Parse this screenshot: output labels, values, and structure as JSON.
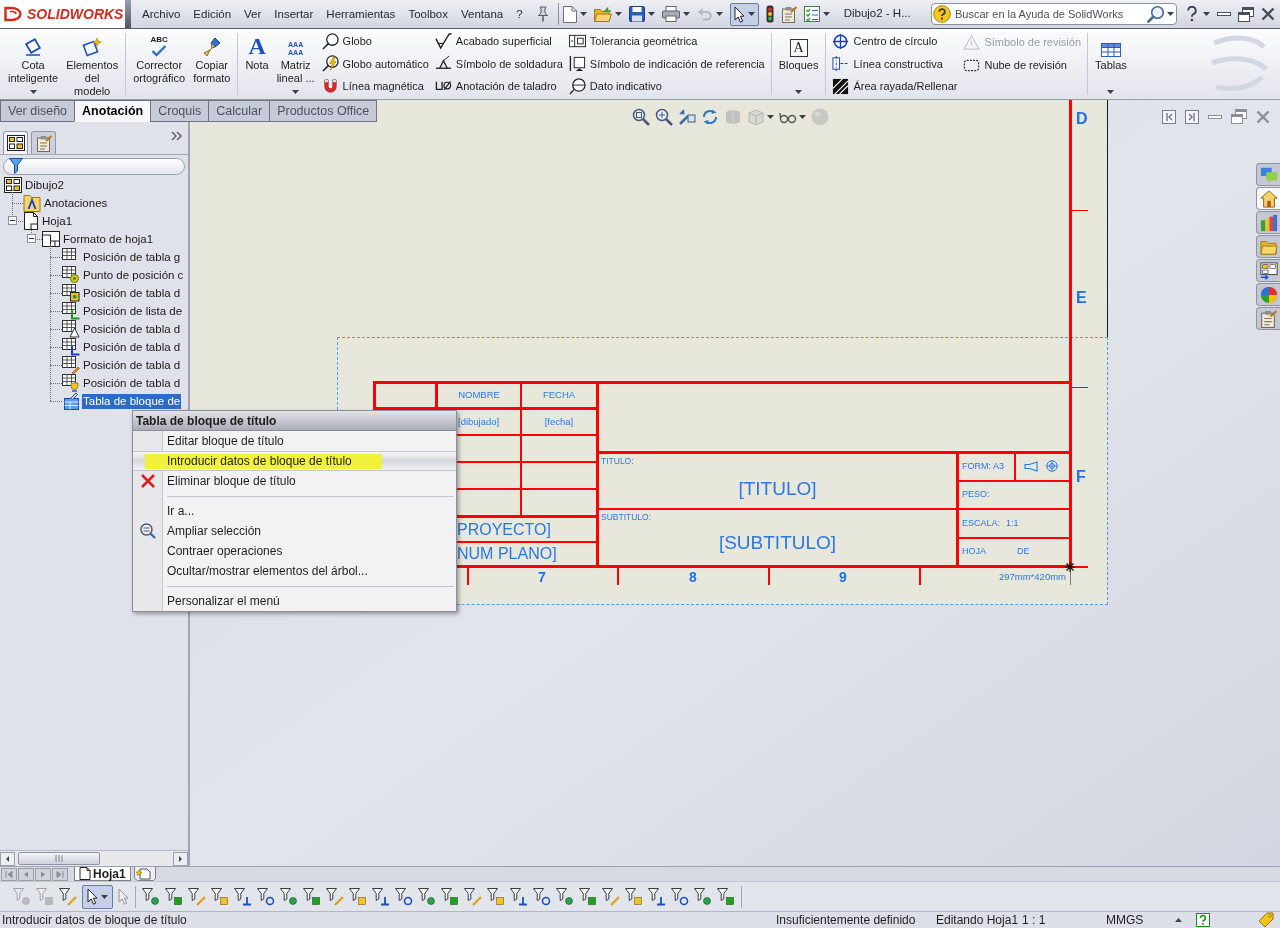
{
  "title_bar": {
    "logo": "SOLIDWORKS",
    "menu": [
      "Archivo",
      "Edición",
      "Ver",
      "Insertar",
      "Herramientas",
      "Toolbox",
      "Ventana",
      "?"
    ],
    "quick_tools": [
      {
        "dropdown": true,
        "selected": false,
        "disabled": false
      },
      {
        "dropdown": true,
        "selected": false,
        "disabled": false
      },
      {
        "dropdown": true,
        "selected": false,
        "disabled": false
      },
      {
        "dropdown": true,
        "selected": false,
        "disabled": false
      },
      {
        "dropdown": true,
        "selected": false,
        "disabled": true
      },
      {
        "dropdown": true,
        "selected": true,
        "disabled": false
      },
      {
        "dropdown": false,
        "selected": false,
        "disabled": false
      },
      {
        "dropdown": false,
        "selected": false,
        "disabled": false
      },
      {
        "dropdown": true,
        "selected": false,
        "disabled": false
      }
    ],
    "document_title": "Dibujo2 - H...",
    "search": {
      "placeholder": "Buscar en la Ayuda de SolidWorks"
    }
  },
  "ribbon": {
    "groups": [
      [
        {
          "kind": "large",
          "label": "Cota\ninteligente",
          "dropdown": true
        },
        {
          "kind": "large",
          "label": "Elementos\ndel\nmodelo",
          "dropdown": false
        }
      ],
      [
        {
          "kind": "large",
          "glyph": "ABC",
          "label": "Corrector\nortográfico",
          "dropdown": false
        },
        {
          "kind": "large",
          "label": "Copiar\nformato",
          "dropdown": false
        }
      ],
      [
        {
          "kind": "large",
          "glyph": "A",
          "label": "Nota",
          "dropdown": false
        },
        {
          "kind": "large",
          "glyph": "AAA\nAAA",
          "label": "Matriz\nlineal ...",
          "dropdown": true
        },
        {
          "kind": "column",
          "items": [
            {
              "label": "Globo",
              "disabled": false
            },
            {
              "label": "Globo automático",
              "disabled": false
            },
            {
              "label": "Línea magnética",
              "disabled": false
            }
          ]
        },
        {
          "kind": "column",
          "items": [
            {
              "label": "Acabado superficial",
              "disabled": false
            },
            {
              "label": "Símbolo de soldadura",
              "disabled": false
            },
            {
              "label": "Anotación de taladro",
              "disabled": false
            }
          ]
        },
        {
          "kind": "column",
          "items": [
            {
              "label": "Tolerancia geométrica",
              "disabled": false
            },
            {
              "label": "Símbolo de indicación de referencia",
              "disabled": false
            },
            {
              "label": "Dato indicativo",
              "disabled": false
            }
          ]
        }
      ],
      [
        {
          "kind": "large",
          "glyph": "A",
          "label": "Bloques",
          "dropdown": true
        }
      ],
      [
        {
          "kind": "column",
          "items": [
            {
              "label": "Centro de círculo",
              "disabled": false
            },
            {
              "label": "Línea constructiva",
              "disabled": false
            },
            {
              "label": "Área rayada/Rellenar",
              "disabled": false
            }
          ]
        },
        {
          "kind": "column",
          "items": [
            {
              "label": "Símbolo de revisión",
              "disabled": true
            },
            {
              "label": "Nube de revisión",
              "disabled": false
            }
          ]
        }
      ],
      [
        {
          "kind": "large",
          "label": "Tablas",
          "dropdown": true
        }
      ]
    ]
  },
  "tabs": [
    {
      "label": "Ver diseño",
      "selected": false
    },
    {
      "label": "Anotación",
      "selected": true
    },
    {
      "label": "Croquis",
      "selected": false
    },
    {
      "label": "Calcular",
      "selected": false
    },
    {
      "label": "Productos Office",
      "selected": false
    }
  ],
  "panel": {
    "tabs": [
      {
        "selected": true
      },
      {
        "selected": false
      }
    ],
    "tree": [
      {
        "label": "Dibujo2",
        "selected": false,
        "children": [
          {
            "label": "Anotaciones",
            "selected": false
          },
          {
            "label": "Hoja1",
            "selected": false,
            "expanded": true,
            "children": [
              {
                "label": "Formato de hoja1",
                "selected": false,
                "expanded": true,
                "children": [
                  {
                    "label": "Posición de tabla g",
                    "selected": false
                  },
                  {
                    "label": "Punto de posición c",
                    "selected": false
                  },
                  {
                    "label": "Posición de tabla d",
                    "selected": false
                  },
                  {
                    "label": "Posición de lista de",
                    "selected": false
                  },
                  {
                    "label": "Posición de tabla d",
                    "selected": false
                  },
                  {
                    "label": "Posición de tabla d",
                    "selected": false
                  },
                  {
                    "label": "Posición de tabla d",
                    "selected": false
                  },
                  {
                    "label": "Posición de tabla d",
                    "selected": false
                  },
                  {
                    "label": "Tabla de bloque de",
                    "selected": true
                  }
                ]
              }
            ]
          }
        ]
      }
    ]
  },
  "view_toolbar": [
    {
      "disabled": false,
      "dropdown": false
    },
    {
      "disabled": false,
      "dropdown": false
    },
    {
      "disabled": false,
      "dropdown": false
    },
    {
      "disabled": false,
      "dropdown": false
    },
    {
      "disabled": true,
      "dropdown": false
    },
    {
      "disabled": true,
      "dropdown": true
    },
    {
      "disabled": false,
      "dropdown": true
    },
    {
      "disabled": true,
      "dropdown": false
    }
  ],
  "drawing": {
    "zones": [
      "D",
      "E",
      "F"
    ],
    "columns": [
      "7",
      "8",
      "9"
    ],
    "sheet_size": "297mm*420mm",
    "title_block": {
      "headers": [
        "NOMBRE",
        "FECHA"
      ],
      "drawn": [
        "[dibujado]",
        "[fecha]"
      ],
      "project": "PROYECTO]",
      "drawing_number": "NUM PLANO]",
      "title_label": "TITULO:",
      "title": "[TITULO]",
      "subtitle_label": "SUBTITULO:",
      "subtitle": "[SUBTITULO]",
      "format": "FORM: A3",
      "weight": "PESO:",
      "scale_label": "ESCALA:",
      "scale": "1:1",
      "sheet_label": "HOJA",
      "of_label": "DE"
    }
  },
  "task_pane": [
    {
      "selected": false
    },
    {
      "selected": true
    },
    {
      "selected": false
    },
    {
      "selected": false
    },
    {
      "selected": false
    },
    {
      "selected": false
    },
    {
      "selected": false
    }
  ],
  "context_menu": {
    "title": "Tabla de bloque de título",
    "sections": [
      [
        {
          "label": "Editar bloque de título",
          "selected": false
        },
        {
          "label": "Introducir datos de bloque de título",
          "selected": true
        },
        {
          "label": "Eliminar bloque de título",
          "selected": false
        }
      ],
      [
        {
          "label": "Ir a...",
          "selected": false
        },
        {
          "label": "Ampliar selección",
          "selected": false
        },
        {
          "label": "Contraer operaciones",
          "selected": false
        },
        {
          "label": "Ocultar/mostrar elementos del árbol...",
          "selected": false
        }
      ],
      [
        {
          "label": "Personalizar el menú",
          "selected": false
        }
      ]
    ]
  },
  "sheet_tabs": [
    {
      "label": "Hoja1",
      "selected": true
    }
  ],
  "selection_toolbar": [
    [
      {
        "kind": "filter",
        "selected": false,
        "disabled": true,
        "dropdown": false
      },
      {
        "kind": "filter",
        "selected": false,
        "disabled": true,
        "dropdown": false
      },
      {
        "kind": "filter",
        "selected": false,
        "disabled": false,
        "dropdown": false
      },
      {
        "kind": "pointer",
        "selected": true,
        "disabled": false,
        "dropdown": true
      },
      {
        "kind": "pointer",
        "selected": false,
        "disabled": true,
        "dropdown": false
      }
    ],
    [
      {
        "kind": "filter",
        "selected": false,
        "disabled": false,
        "dropdown": false
      },
      {
        "kind": "filter",
        "selected": false,
        "disabled": false,
        "dropdown": false
      },
      {
        "kind": "filter",
        "selected": false,
        "disabled": false,
        "dropdown": false
      },
      {
        "kind": "filter",
        "selected": false,
        "disabled": false,
        "dropdown": false
      },
      {
        "kind": "filter",
        "selected": false,
        "disabled": false,
        "dropdown": false
      },
      {
        "kind": "filter",
        "selected": false,
        "disabled": false,
        "dropdown": false
      },
      {
        "kind": "filter",
        "selected": false,
        "disabled": false,
        "dropdown": false
      },
      {
        "kind": "filter",
        "selected": false,
        "disabled": false,
        "dropdown": false
      },
      {
        "kind": "filter",
        "selected": false,
        "disabled": false,
        "dropdown": false
      },
      {
        "kind": "filter",
        "selected": false,
        "disabled": false,
        "dropdown": false
      },
      {
        "kind": "filter",
        "selected": false,
        "disabled": false,
        "dropdown": false
      },
      {
        "kind": "filter",
        "selected": false,
        "disabled": false,
        "dropdown": false
      },
      {
        "kind": "filter",
        "selected": false,
        "disabled": false,
        "dropdown": false
      },
      {
        "kind": "filter",
        "selected": false,
        "disabled": false,
        "dropdown": false
      },
      {
        "kind": "filter",
        "selected": false,
        "disabled": false,
        "dropdown": false
      },
      {
        "kind": "filter",
        "selected": false,
        "disabled": false,
        "dropdown": false
      },
      {
        "kind": "filter",
        "selected": false,
        "disabled": false,
        "dropdown": false
      },
      {
        "kind": "filter",
        "selected": false,
        "disabled": false,
        "dropdown": false
      },
      {
        "kind": "filter",
        "selected": false,
        "disabled": false,
        "dropdown": false
      },
      {
        "kind": "filter",
        "selected": false,
        "disabled": false,
        "dropdown": false
      },
      {
        "kind": "filter",
        "selected": false,
        "disabled": false,
        "dropdown": false
      },
      {
        "kind": "filter",
        "selected": false,
        "disabled": false,
        "dropdown": false
      },
      {
        "kind": "filter",
        "selected": false,
        "disabled": false,
        "dropdown": false
      },
      {
        "kind": "filter",
        "selected": false,
        "disabled": false,
        "dropdown": false
      },
      {
        "kind": "filter",
        "selected": false,
        "disabled": false,
        "dropdown": false
      },
      {
        "kind": "filter",
        "selected": false,
        "disabled": false,
        "dropdown": false
      }
    ]
  ],
  "status_bar": {
    "message": "Introducir datos de bloque de título",
    "fields": [
      "Insuficientemente definido",
      "Editando Hoja1",
      "1 : 1",
      "MMGS"
    ]
  }
}
